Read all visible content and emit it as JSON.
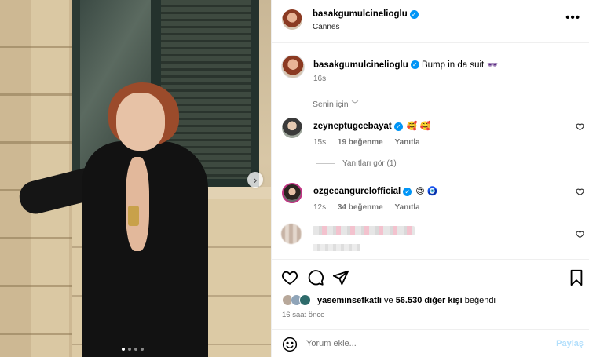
{
  "photo": {
    "carousel_total": 4,
    "carousel_active": 1
  },
  "header": {
    "username": "basakgumulcinelioglu",
    "location": "Cannes",
    "more_icon": "more-horizontal-icon"
  },
  "caption": {
    "username": "basakgumulcinelioglu",
    "text": "Bump in da suit",
    "emoji": "🕶",
    "time": "16s"
  },
  "comments_filter": {
    "label": "Senin için"
  },
  "comments": [
    {
      "username": "zeyneptugcebayat",
      "emojis": "🥰 🥰",
      "time": "15s",
      "likes": "19 beğenme",
      "reply": "Yanıtla"
    },
    {
      "username": "ozgecangurelofficial",
      "emojis": "😍 🧿",
      "time": "12s",
      "likes": "34 beğenme",
      "reply": "Yanıtla"
    }
  ],
  "replies_toggle": "Yanıtları gör (1)",
  "likes": {
    "first_user": "yaseminsefkatli",
    "connector": "ve",
    "others": "56.530 diğer kişi",
    "suffix": "beğendi"
  },
  "post_time": "16 saat önce",
  "comment_input": {
    "placeholder": "Yorum ekle...",
    "post_label": "Paylaş"
  },
  "colors": {
    "verified": "#0095f6",
    "post_button_disabled": "#b2dffc",
    "muted_text": "#737373"
  }
}
